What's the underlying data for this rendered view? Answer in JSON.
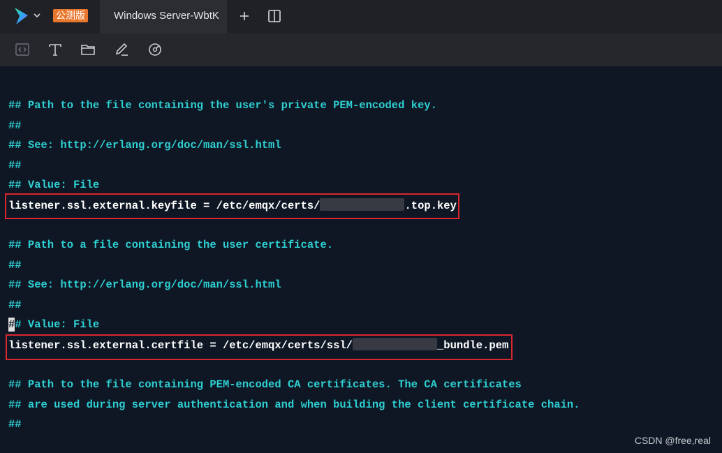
{
  "tabbar": {
    "badge": "公测版",
    "active_tab": "Windows Server-WbtK"
  },
  "toolbar": {
    "icons": [
      "code-icon",
      "text-icon",
      "folder-icon",
      "edit-icon",
      "dashboard-icon"
    ]
  },
  "terminal": {
    "lines": [
      {
        "text": "## Path to the file containing the user's private PEM-encoded key."
      },
      {
        "text": "##"
      },
      {
        "text": "## See: http://erlang.org/doc/man/ssl.html"
      },
      {
        "text": "##"
      },
      {
        "text": "## Value: File"
      },
      {
        "prefix": "listener.ssl.external.keyfile = /etc/emqx/certs/",
        "suffix": ".top.key"
      },
      {
        "text": ""
      },
      {
        "text": "## Path to a file containing the user certificate."
      },
      {
        "text": "##"
      },
      {
        "text": "## See: http://erlang.org/doc/man/ssl.html"
      },
      {
        "text": "##"
      },
      {
        "cursor": "#",
        "text": "# Value: File"
      },
      {
        "prefix": "listener.ssl.external.certfile = /etc/emqx/certs/ssl/",
        "suffix": "_bundle.pem"
      },
      {
        "text": ""
      },
      {
        "text": "## Path to the file containing PEM-encoded CA certificates. The CA certificates"
      },
      {
        "text": "## are used during server authentication and when building the client certificate chain."
      },
      {
        "text": "##"
      }
    ]
  },
  "watermark": "CSDN @free,real",
  "colors": {
    "comment": "#2ecfd2",
    "command": "#ffffff",
    "highlight": "#d9282f",
    "badge": "#e8772e"
  }
}
